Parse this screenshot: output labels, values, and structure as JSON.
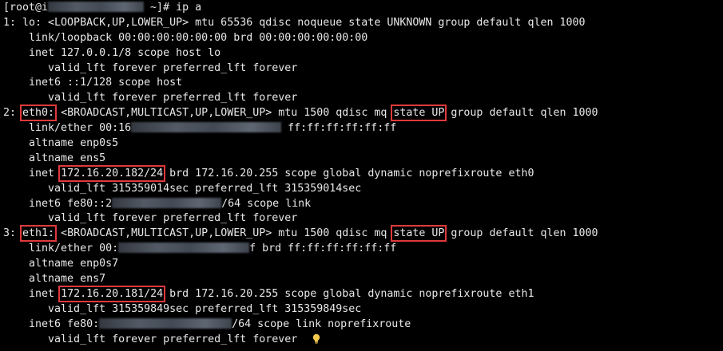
{
  "terminal": {
    "lines": [
      {
        "a": "[root@i",
        "blur1": "",
        "b": " ~]# ip a"
      },
      {
        "text": "1: lo: <LOOPBACK,UP,LOWER_UP> mtu 65536 qdisc noqueue state UNKNOWN group default qlen 1000"
      },
      {
        "text": "    link/loopback 00:00:00:00:00:00 brd 00:00:00:00:00:00"
      },
      {
        "text": "    inet 127.0.0.1/8 scope host lo"
      },
      {
        "text": "       valid_lft forever preferred_lft forever"
      },
      {
        "text": "    inet6 ::1/128 scope host"
      },
      {
        "text": "       valid_lft forever preferred_lft forever"
      },
      {
        "pre": "2: ",
        "iface": "eth0:",
        "mid": " <BROADCAST,MULTICAST,UP,LOWER_UP> mtu 1500 qdisc mq ",
        "state": "state UP",
        "post": " group default qlen 1000"
      },
      {
        "a": "    link/ether 00:16",
        "b": " ff:ff:ff:ff:ff:ff"
      },
      {
        "text": "    altname enp0s5"
      },
      {
        "text": "    altname ens5"
      },
      {
        "pre": "    inet ",
        "ip": "172.16.20.182/24",
        "post": " brd 172.16.20.255 scope global dynamic noprefixroute eth0"
      },
      {
        "text": "       valid_lft 315359014sec preferred_lft 315359014sec"
      },
      {
        "a": "    inet6 fe80::2",
        "b": "/64 scope link"
      },
      {
        "text": "       valid_lft forever preferred_lft forever"
      },
      {
        "pre": "3: ",
        "iface": "eth1:",
        "mid": " <BROADCAST,MULTICAST,UP,LOWER_UP> mtu 1500 qdisc mq ",
        "state": "state UP",
        "post": " group default qlen 1000"
      },
      {
        "a": "    link/ether 00:",
        "b": "f brd ff:ff:ff:ff:ff:ff"
      },
      {
        "text": "    altname enp0s7"
      },
      {
        "text": "    altname ens7"
      },
      {
        "pre": "    inet ",
        "ip": "172.16.20.181/24",
        "post": " brd 172.16.20.255 scope global dynamic noprefixroute eth1"
      },
      {
        "text": "       valid_lft 315359849sec preferred_lft 315359849sec"
      },
      {
        "a": "    inet6 fe80:",
        "b": "/64 scope link noprefixroute"
      },
      {
        "text": "       valid_lft forever preferred_lft forever"
      }
    ]
  },
  "colors": {
    "background": "#000000",
    "text": "#e8e8e8",
    "highlight_box": "#e0393b",
    "bulb": "#f2c94c"
  },
  "icons": {
    "bulb": "lightbulb-icon"
  }
}
